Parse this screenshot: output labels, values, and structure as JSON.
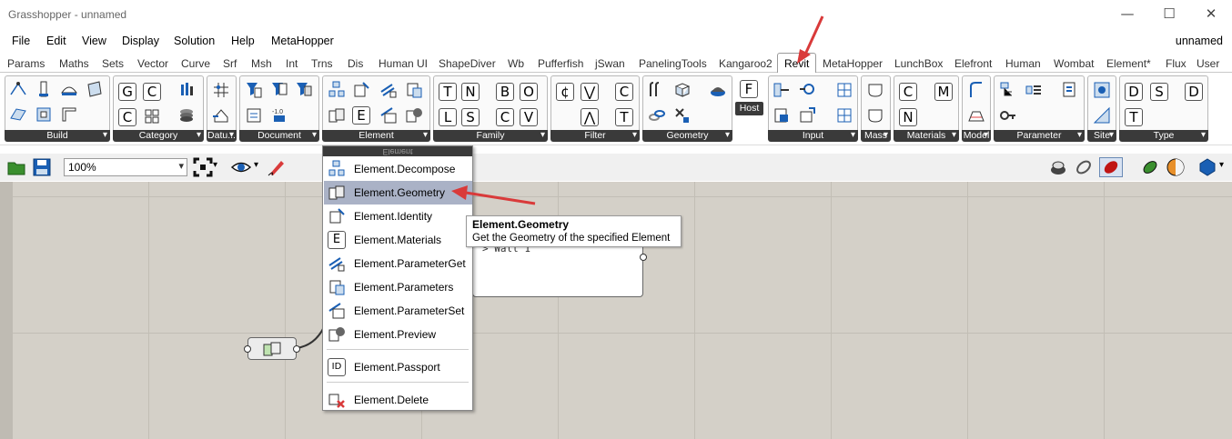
{
  "window": {
    "title": "Grasshopper - unnamed",
    "min": "—",
    "max": "☐",
    "close": "✕"
  },
  "menu": {
    "items": [
      "File",
      "Edit",
      "View",
      "Display",
      "Solution",
      "Help",
      "MetaHopper"
    ],
    "doc": "unnamed"
  },
  "tabs": [
    "Params",
    "Maths",
    "Sets",
    "Vector",
    "Curve",
    "Srf",
    "Msh",
    "Int",
    "Trns",
    "Dis",
    "Human UI",
    "ShapeDiver",
    "Wb",
    "Pufferfish",
    "jSwan",
    "PanelingTools",
    "Kangaroo2",
    "Revit",
    "MetaHopper",
    "LunchBox",
    "Elefront",
    "Human",
    "Wombat",
    "Element*",
    "Flux",
    "User"
  ],
  "active_tab": "Revit",
  "ribbon": {
    "groups": [
      "Build",
      "Category",
      "Datu...",
      "Document",
      "Element",
      "Family",
      "Filter",
      "Geometry",
      "Input",
      "Mass",
      "Materials",
      "Model",
      "Parameter",
      "Site",
      "Type"
    ],
    "host_label": "Host",
    "letters": {
      "category": [
        "G",
        "C",
        "C"
      ],
      "element": [
        "E"
      ],
      "family": [
        "T",
        "N",
        "B",
        "O",
        "L",
        "S",
        "C",
        "V"
      ],
      "filter": [
        "¢",
        "⋁",
        "⋀"
      ],
      "filter2": [
        "C",
        "T"
      ],
      "host": [
        "F"
      ],
      "materials": [
        "C",
        "M",
        "N"
      ],
      "type": [
        "D",
        "S",
        "D",
        "T"
      ]
    }
  },
  "toolbar": {
    "zoom": "100%"
  },
  "canvas": {
    "panel_text": "> Wall 1"
  },
  "dropdown": {
    "header": "Element",
    "items": [
      "Element.Decompose",
      "Element.Geometry",
      "Element.Identity",
      "Element.Materials",
      "Element.ParameterGet",
      "Element.Parameters",
      "Element.ParameterSet",
      "Element.Preview",
      "Element.Passport",
      "Element.Delete"
    ],
    "materials_icon": "E",
    "passport_icon": "ID"
  },
  "tooltip": {
    "title": "Element.Geometry",
    "desc": "Get the Geometry of the specified Element"
  },
  "colors": {
    "accent_red": "#d93a3a",
    "highlight": "#aab2c6",
    "group_bar": "#3a3a3a",
    "canvas": "#d4d0c8"
  }
}
